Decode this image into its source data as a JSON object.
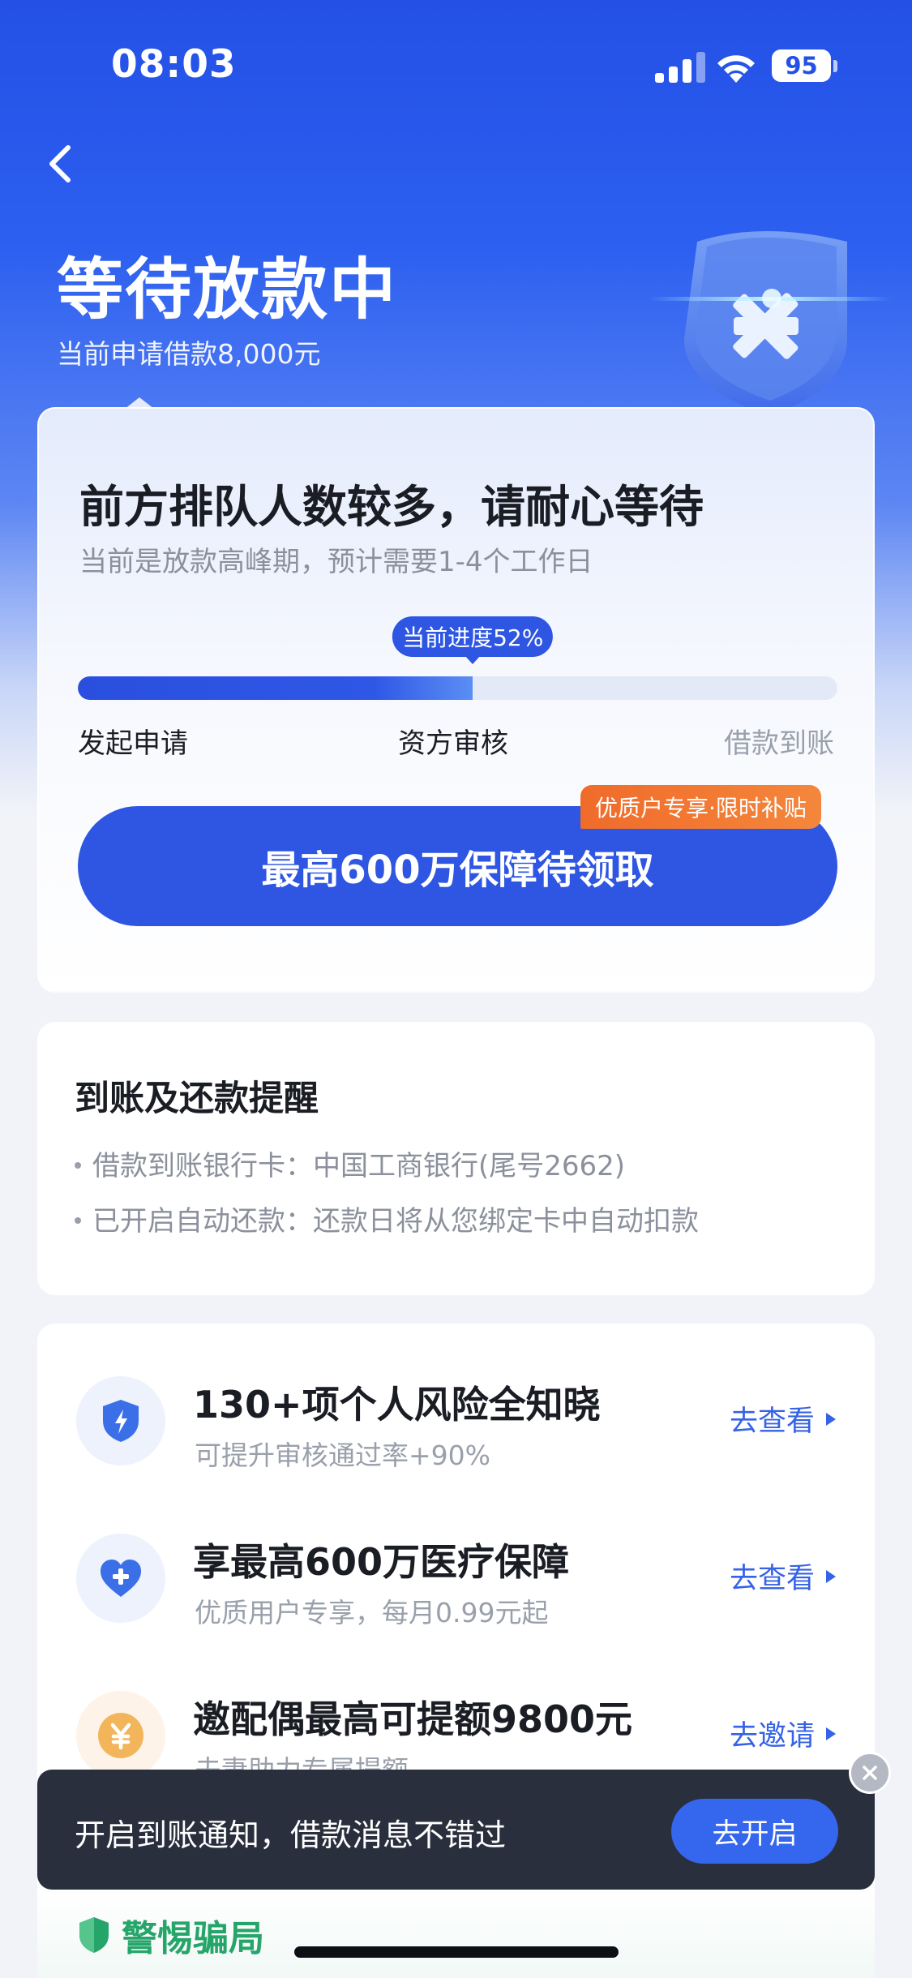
{
  "status_bar": {
    "time": "08:03",
    "battery": "95"
  },
  "header": {
    "title": "等待放款中",
    "subtitle": "当前申请借款8,000元"
  },
  "progress_card": {
    "title": "前方排队人数较多，请耐心等待",
    "subtitle": "当前是放款高峰期，预计需要1-4个工作日",
    "progress_label": "当前进度52%",
    "progress_percent": 52,
    "steps": [
      "发起申请",
      "资方审核",
      "借款到账"
    ],
    "cta_label": "最高600万保障待领取",
    "cta_badge": "优质户专享·限时补贴"
  },
  "reminder": {
    "title": "到账及还款提醒",
    "items": [
      "借款到账银行卡：中国工商银行(尾号2662)",
      "已开启自动还款：还款日将从您绑定卡中自动扣款"
    ]
  },
  "services": [
    {
      "title": "130+项个人风险全知晓",
      "subtitle": "可提升审核通过率+90%",
      "action": "去查看",
      "icon": "shield-lightning-icon"
    },
    {
      "title": "享最高600万医疗保障",
      "subtitle": "优质用户专享，每月0.99元起",
      "action": "去查看",
      "icon": "heart-plus-icon"
    },
    {
      "title": "邀配偶最高可提额9800元",
      "subtitle": "夫妻助力专属提额",
      "action": "去邀请",
      "icon": "yuan-coin-icon"
    }
  ],
  "fraud_warning": {
    "label": "警惕骗局"
  },
  "toast": {
    "text": "开启到账通知，借款消息不错过",
    "button": "去开启"
  },
  "colors": {
    "primary": "#2E56E2",
    "accent_orange": "#F06B2A",
    "safe_green": "#26A56A",
    "toast_bg": "#2A2F3D"
  }
}
